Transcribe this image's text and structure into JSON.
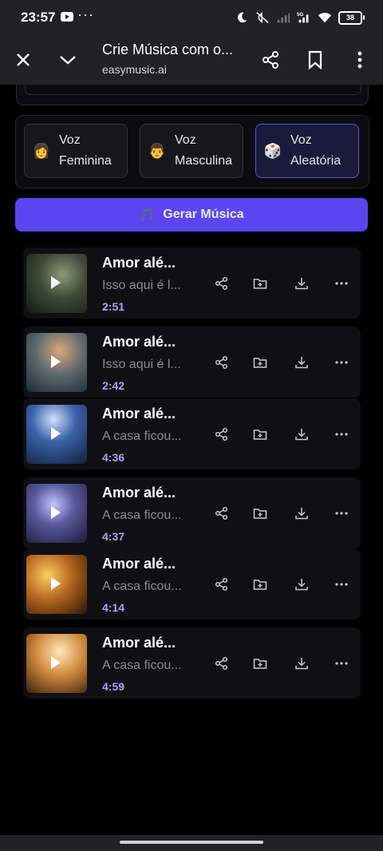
{
  "status_bar": {
    "time": "23:57",
    "dots": "···",
    "battery": "38"
  },
  "browser": {
    "title": "Crie Música com o...",
    "url": "easymusic.ai"
  },
  "voices": [
    {
      "emoji": "👩",
      "line1": "Voz",
      "line2": "Feminina",
      "active": false
    },
    {
      "emoji": "👨",
      "line1": "Voz",
      "line2": "Masculina",
      "active": false
    },
    {
      "emoji": "🎲",
      "line1": "Voz",
      "line2": "Aleatória",
      "active": true
    }
  ],
  "generate": {
    "icon": "🎵",
    "label": "Gerar Música"
  },
  "songs": [
    {
      "title": "Amor alé...",
      "desc": "Isso aqui é l...",
      "duration": "2:51"
    },
    {
      "title": "Amor alé...",
      "desc": "Isso aqui é l...",
      "duration": "2:42"
    },
    {
      "title": "Amor alé...",
      "desc": "A casa ficou...",
      "duration": "4:36"
    },
    {
      "title": "Amor alé...",
      "desc": "A casa ficou...",
      "duration": "4:37"
    },
    {
      "title": "Amor alé...",
      "desc": "A casa ficou...",
      "duration": "4:14"
    },
    {
      "title": "Amor alé...",
      "desc": "A casa ficou...",
      "duration": "4:59"
    }
  ],
  "icons": [
    "close-icon",
    "chevron-down-icon",
    "share-icon",
    "bookmark-icon",
    "more-vertical-icon",
    "play-icon",
    "add-folder-icon",
    "download-icon",
    "more-horizontal-icon"
  ],
  "colors": {
    "accent": "#5a45f0",
    "duration": "#a9a3f4",
    "card": "#101014"
  }
}
